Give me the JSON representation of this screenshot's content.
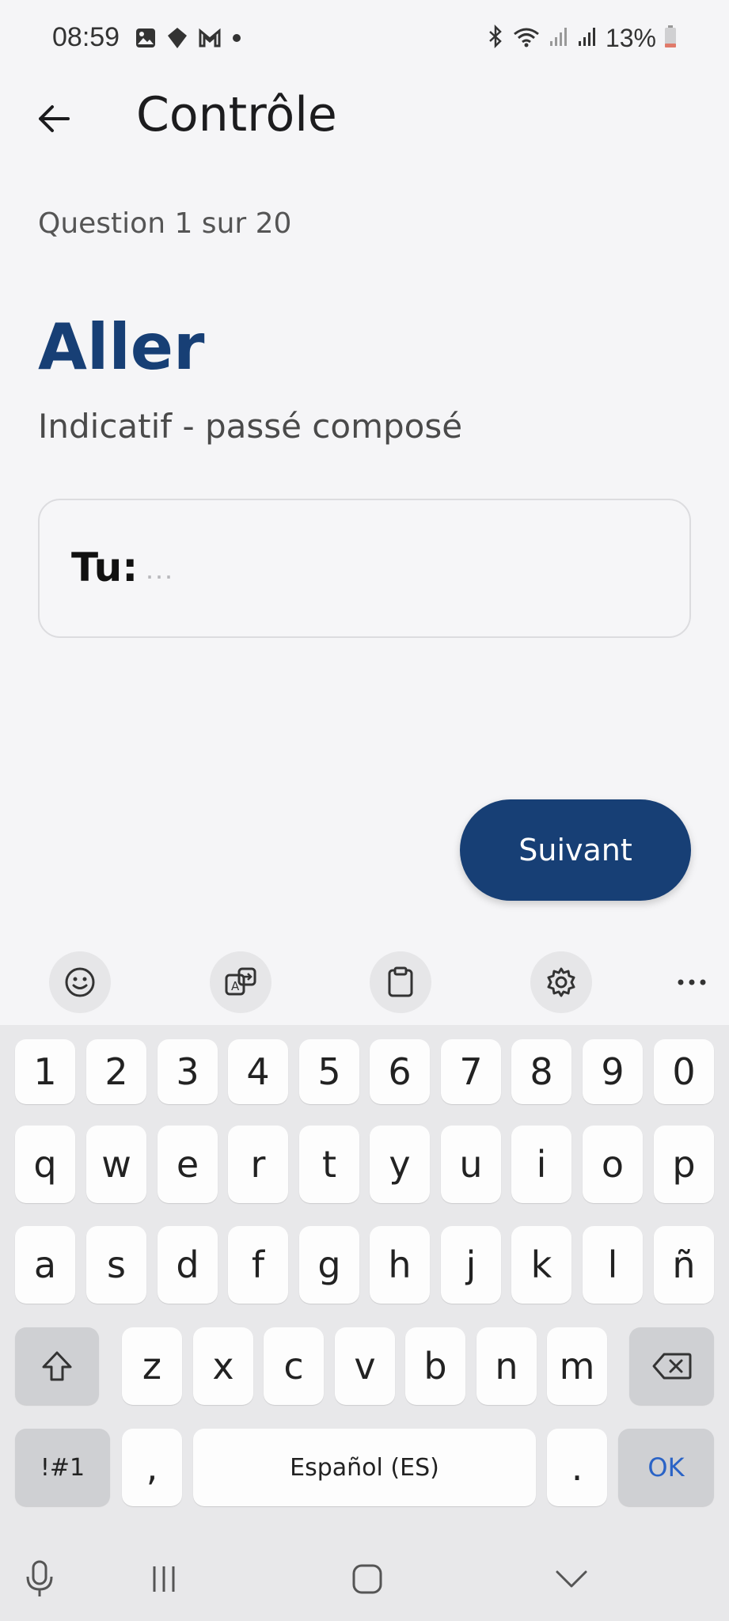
{
  "status_bar": {
    "time": "08:59",
    "battery": "13%",
    "icons": [
      "image-icon",
      "diamond-app-icon",
      "gmail-icon",
      "dot-icon",
      "bluetooth-icon",
      "wifi-icon",
      "signal-icon",
      "signal-icon",
      "battery-icon"
    ]
  },
  "app_bar": {
    "title": "Contrôle",
    "back_icon": "arrow-left-icon"
  },
  "quiz": {
    "counter": "Question 1 sur 20",
    "verb": "Aller",
    "tense": "Indicatif - passé composé",
    "pronoun": "Tu:",
    "answer_placeholder": "...",
    "next_label": "Suivant"
  },
  "colors": {
    "accent": "#173f75",
    "background": "#f5f5f7",
    "ok_key": "#2a63c6"
  },
  "keyboard": {
    "toolbar_icons": [
      "emoji-icon",
      "translate-icon",
      "clipboard-icon",
      "settings-icon",
      "more-icon"
    ],
    "number_row": [
      "1",
      "2",
      "3",
      "4",
      "5",
      "6",
      "7",
      "8",
      "9",
      "0"
    ],
    "row1": [
      "q",
      "w",
      "e",
      "r",
      "t",
      "y",
      "u",
      "i",
      "o",
      "p"
    ],
    "row2": [
      "a",
      "s",
      "d",
      "f",
      "g",
      "h",
      "j",
      "k",
      "l",
      "ñ"
    ],
    "row3": [
      "z",
      "x",
      "c",
      "v",
      "b",
      "n",
      "m"
    ],
    "symbols_label": "!#1",
    "comma": ",",
    "space_label": "Español (ES)",
    "period": ".",
    "ok_label": "OK"
  },
  "nav_bar": {
    "icons": [
      "microphone-icon",
      "recent-apps-icon",
      "home-icon",
      "hide-keyboard-icon"
    ]
  }
}
